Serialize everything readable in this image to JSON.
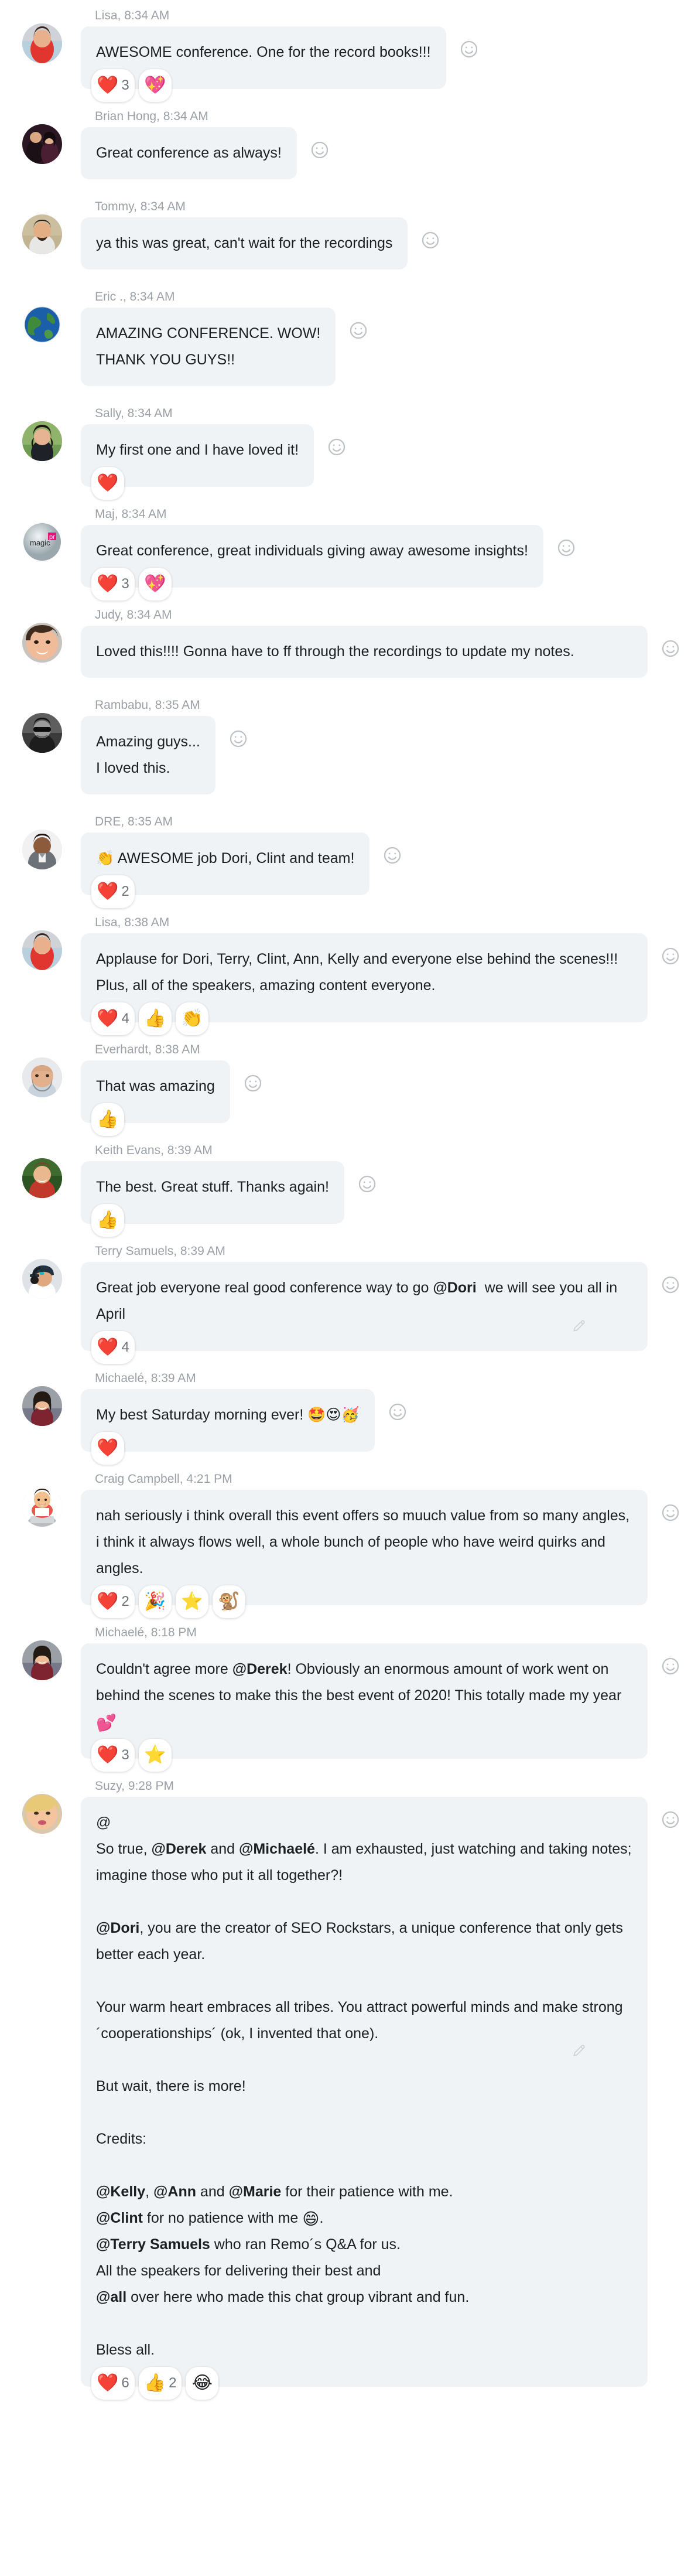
{
  "app": {
    "view": "group-chat-thread",
    "bubble_bg": "#f0f3f6",
    "text_color": "#1c1e21",
    "meta_color": "#9aa0a6",
    "heart_color": "#ed1c24"
  },
  "icons": {
    "add_reaction": "smiley-face-icon",
    "edit": "pencil-icon"
  },
  "messages": [
    {
      "id": "m1",
      "author": "Lisa",
      "time": "8:34 AM",
      "meta": "Lisa, 8:34 AM",
      "avatar": "woman-red-shirt",
      "width": "w-mid",
      "lines": [
        "AWESOME conference. One for the record books!!!"
      ],
      "reactions": [
        {
          "emoji": "❤️",
          "name": "heart-reaction",
          "count": "3"
        },
        {
          "emoji": "💖",
          "name": "sparkling-heart-reaction",
          "count": ""
        }
      ]
    },
    {
      "id": "m2",
      "author": "Brian Hong",
      "time": "8:34 AM",
      "meta": "Brian Hong, 8:34 AM",
      "avatar": "couple-formal",
      "width": "w-narrow",
      "lines": [
        "Great conference as always!"
      ],
      "reactions": []
    },
    {
      "id": "m3",
      "author": "Tommy",
      "time": "8:34 AM",
      "meta": "Tommy, 8:34 AM",
      "avatar": "man-field",
      "width": "w-mid",
      "lines": [
        "ya this was great, can't wait for the recordings"
      ],
      "reactions": []
    },
    {
      "id": "m4",
      "author": "Eric .",
      "time": "8:34 AM",
      "meta": "Eric ., 8:34 AM",
      "avatar": "earth-globe",
      "width": "w-narrow",
      "lines": [
        "AMAZING CONFERENCE. WOW!",
        "THANK YOU GUYS!!"
      ],
      "reactions": []
    },
    {
      "id": "m5",
      "author": "Sally",
      "time": "8:34 AM",
      "meta": "Sally, 8:34 AM",
      "avatar": "woman-dark-hair",
      "width": "w-narrow",
      "lines": [
        "My first one and I have loved it!"
      ],
      "reactions": [
        {
          "emoji": "❤️",
          "name": "heart-reaction",
          "count": ""
        }
      ]
    },
    {
      "id": "m6",
      "author": "Maj",
      "time": "8:34 AM",
      "meta": "Maj, 8:34 AM",
      "avatar": "magic-pr-logo",
      "width": "w-wide",
      "lines": [
        "Great conference, great individuals giving away awesome insights!"
      ],
      "reactions": [
        {
          "emoji": "❤️",
          "name": "heart-reaction",
          "count": "3"
        },
        {
          "emoji": "💖",
          "name": "sparkling-heart-reaction",
          "count": ""
        }
      ]
    },
    {
      "id": "m7",
      "author": "Judy",
      "time": "8:34 AM",
      "meta": "Judy, 8:34 AM",
      "avatar": "woman-closeup",
      "width": "w-full",
      "lines": [
        "Loved this!!!! Gonna have to ff through the recordings to update my notes."
      ],
      "reactions": []
    },
    {
      "id": "m8",
      "author": "Rambabu",
      "time": "8:35 AM",
      "meta": "Rambabu, 8:35 AM",
      "avatar": "man-sunglasses-bw",
      "width": "w-narrow",
      "lines": [
        "Amazing guys...",
        "I loved this."
      ],
      "reactions": []
    },
    {
      "id": "m9",
      "author": "DRE",
      "time": "8:35 AM",
      "meta": "DRE, 8:35 AM",
      "avatar": "man-gray-polo",
      "width": "w-mid",
      "lines": [
        "👏 AWESOME job Dori, Clint and team!"
      ],
      "reactions": [
        {
          "emoji": "❤️",
          "name": "heart-reaction",
          "count": "2"
        }
      ]
    },
    {
      "id": "m10",
      "author": "Lisa",
      "time": "8:38 AM",
      "meta": "Lisa, 8:38 AM",
      "avatar": "woman-red-shirt",
      "width": "w-full",
      "lines": [
        "Applause for Dori, Terry, Clint, Ann, Kelly and everyone else behind the scenes!!! Plus, all of the speakers, amazing content everyone."
      ],
      "reactions": [
        {
          "emoji": "❤️",
          "name": "heart-reaction",
          "count": "4"
        },
        {
          "emoji": "👍",
          "name": "thumbs-up-reaction",
          "count": ""
        },
        {
          "emoji": "👏",
          "name": "clapping-hands-reaction",
          "count": ""
        }
      ]
    },
    {
      "id": "m11",
      "author": "Everhardt",
      "time": "8:38 AM",
      "meta": "Everhardt, 8:38 AM",
      "avatar": "bald-man-beard",
      "width": "w-narrow",
      "lines": [
        "That was amazing"
      ],
      "reactions": [
        {
          "emoji": "👍",
          "name": "thumbs-up-reaction",
          "count": ""
        }
      ]
    },
    {
      "id": "m12",
      "author": "Keith Evans",
      "time": "8:39 AM",
      "meta": "Keith Evans, 8:39 AM",
      "avatar": "man-green-background",
      "width": "w-narrow",
      "lines": [
        "The best. Great stuff. Thanks again!"
      ],
      "reactions": [
        {
          "emoji": "👍",
          "name": "thumbs-up-reaction",
          "count": ""
        }
      ]
    },
    {
      "id": "m13",
      "author": "Terry Samuels",
      "time": "8:39 AM",
      "meta": "Terry Samuels, 8:39 AM",
      "avatar": "man-cap-headset",
      "width": "w-full",
      "html_lines": [
        "Great job everyone real good conference way to go <b>@Dori</b>&nbsp; we will see you all in April"
      ],
      "has_edit": true,
      "reactions": [
        {
          "emoji": "❤️",
          "name": "heart-reaction",
          "count": "4"
        }
      ]
    },
    {
      "id": "m14",
      "author": "Michaelé",
      "time": "8:39 AM",
      "meta": "Michaelé, 8:39 AM",
      "avatar": "woman-smiling-maroon",
      "width": "w-mid",
      "lines": [
        "My best Saturday morning ever! 🤩😍🥳"
      ],
      "reactions": [
        {
          "emoji": "❤️",
          "name": "heart-reaction",
          "count": ""
        }
      ]
    },
    {
      "id": "m15",
      "author": "Craig Campbell",
      "time": "4:21 PM",
      "meta": "Craig Campbell, 4:21 PM",
      "avatar": "cartoon-man-laptop",
      "width": "w-full",
      "lines": [
        "nah seriously i think overall this event offers so muuch value from so many angles, i think it always flows well, a whole bunch of people who have weird quirks and angles."
      ],
      "reactions": [
        {
          "emoji": "❤️",
          "name": "heart-reaction",
          "count": "2"
        },
        {
          "emoji": "🎉",
          "name": "party-popper-reaction",
          "count": ""
        },
        {
          "emoji": "⭐",
          "name": "star-reaction",
          "count": ""
        },
        {
          "emoji": "🐒",
          "name": "monkey-reaction",
          "count": ""
        }
      ]
    },
    {
      "id": "m16",
      "author": "Michaelé",
      "time": "8:18 PM",
      "meta": "Michaelé, 8:18 PM",
      "avatar": "woman-smiling-maroon",
      "width": "w-full",
      "html_lines": [
        "Couldn't agree more <b>@Derek</b>! Obviously an enormous amount of work went on behind the scenes to make this the best event of 2020! This totally made my year <span class=\"emoji-inline\">💕</span>"
      ],
      "reactions": [
        {
          "emoji": "❤️",
          "name": "heart-reaction",
          "count": "3"
        },
        {
          "emoji": "⭐",
          "name": "star-reaction",
          "count": ""
        }
      ]
    },
    {
      "id": "m17",
      "author": "Suzy",
      "time": "9:28 PM",
      "meta": "Suzy, 9:28 PM",
      "avatar": "blonde-woman-closeup",
      "width": "w-full",
      "has_edit": true,
      "html_lines": [
        "@",
        "So true, <b>@Derek</b> and <b>@Michaelé</b>. I am exhausted, just watching and taking notes; imagine those who put it all together?!",
        "__BLANK__",
        "<b>@Dori</b>, you are the creator of SEO Rockstars, a unique conference that only gets better each year.",
        "__BLANK__",
        "Your warm heart embraces all tribes. You attract powerful minds and make strong ´cooperationships´ (ok, I invented that one).",
        "__BLANK__",
        "But wait, there is more!",
        "__BLANK__",
        "Credits:",
        "__BLANK__",
        "<b>@Kelly</b>, <b>@Ann</b> and <b>@Marie</b> for their patience with me.",
        "<b>@Clint</b> for no patience with me <span class=\"emoji-inline\">😄</span>.",
        "<b>@Terry Samuels</b> who ran Remo´s Q&amp;A for us.",
        "All the speakers for delivering their best and",
        "<b>@all</b> over here who made this chat group vibrant and fun.",
        "__BLANK__",
        "Bless all."
      ],
      "reactions": [
        {
          "emoji": "❤️",
          "name": "heart-reaction",
          "count": "6"
        },
        {
          "emoji": "👍",
          "name": "thumbs-up-reaction",
          "count": "2"
        },
        {
          "emoji": "😂",
          "name": "laughing-reaction",
          "count": ""
        }
      ]
    }
  ]
}
